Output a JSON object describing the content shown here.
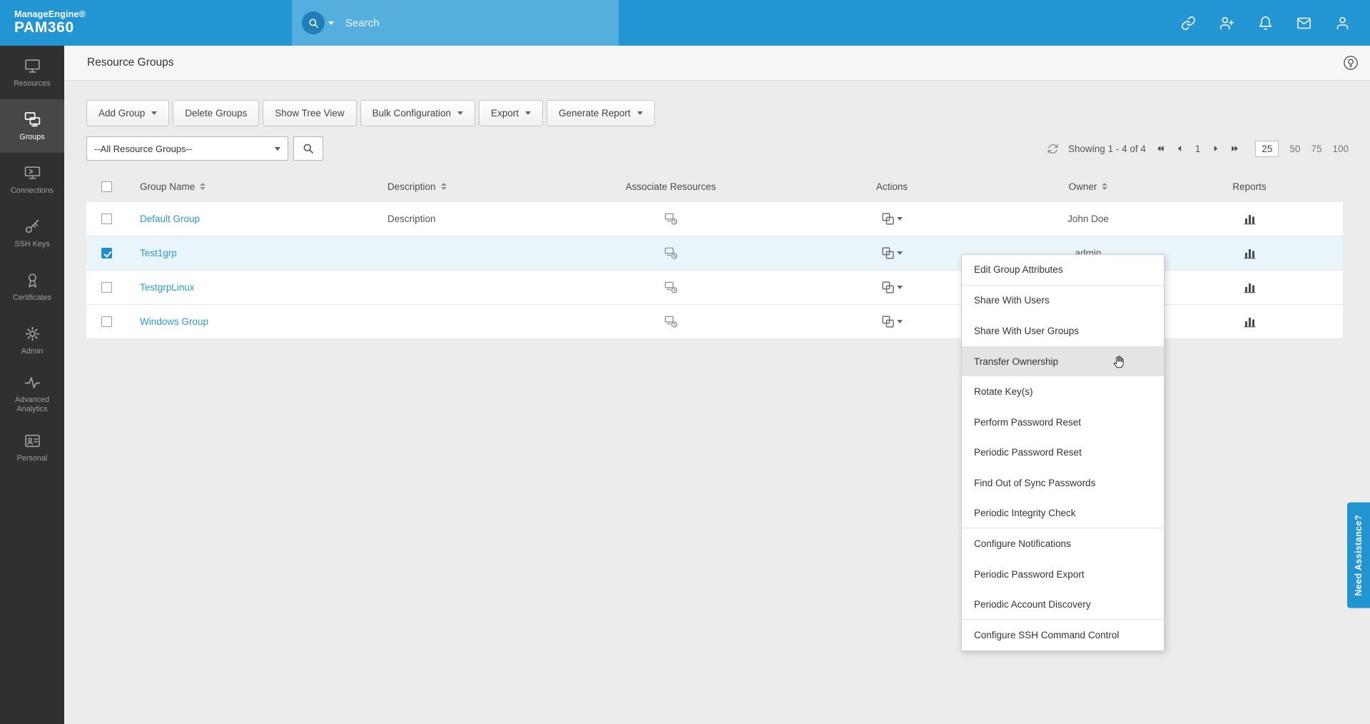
{
  "topbar": {
    "brand_line1": "ManageEngine®",
    "brand_line2": "PAM360",
    "search_placeholder": "Search"
  },
  "sidebar": {
    "items": [
      {
        "label": "Resources",
        "active": false
      },
      {
        "label": "Groups",
        "active": true
      },
      {
        "label": "Connections",
        "active": false
      },
      {
        "label": "SSH Keys",
        "active": false
      },
      {
        "label": "Certificates",
        "active": false
      },
      {
        "label": "Admin",
        "active": false
      },
      {
        "label": "Advanced Analytics",
        "active": false
      },
      {
        "label": "Personal",
        "active": false
      }
    ]
  },
  "page": {
    "title": "Resource Groups"
  },
  "toolbar": {
    "buttons": [
      {
        "label": "Add Group",
        "caret": true
      },
      {
        "label": "Delete Groups",
        "caret": false
      },
      {
        "label": "Show Tree View",
        "caret": false
      },
      {
        "label": "Bulk Configuration",
        "caret": true
      },
      {
        "label": "Export",
        "caret": true
      },
      {
        "label": "Generate Report",
        "caret": true
      }
    ]
  },
  "filter": {
    "selected_option": "--All Resource Groups--"
  },
  "pagination": {
    "showing_text": "Showing 1 - 4 of 4",
    "current_page": "1",
    "page_sizes": [
      "25",
      "50",
      "75",
      "100"
    ],
    "selected_size": "25"
  },
  "table": {
    "columns": [
      {
        "label": "Group Name",
        "sortable": true
      },
      {
        "label": "Description",
        "sortable": true
      },
      {
        "label": "Associate Resources",
        "sortable": false
      },
      {
        "label": "Actions",
        "sortable": false
      },
      {
        "label": "Owner",
        "sortable": true
      },
      {
        "label": "Reports",
        "sortable": false
      }
    ],
    "rows": [
      {
        "name": "Default Group",
        "description": "Description",
        "owner": "John Doe",
        "checked": false,
        "selected": false
      },
      {
        "name": "Test1grp",
        "description": "",
        "owner": "admin",
        "checked": true,
        "selected": true
      },
      {
        "name": "TestgrpLinux",
        "description": "",
        "owner": "",
        "checked": false,
        "selected": false
      },
      {
        "name": "Windows Group",
        "description": "",
        "owner": "",
        "checked": false,
        "selected": false
      }
    ]
  },
  "context_menu": {
    "items": [
      {
        "label": "Edit Group Attributes",
        "divider_after": true
      },
      {
        "label": "Share With Users"
      },
      {
        "label": "Share With User Groups"
      },
      {
        "label": "Transfer Ownership",
        "highlighted": true
      },
      {
        "label": "Rotate Key(s)"
      },
      {
        "label": "Perform Password Reset"
      },
      {
        "label": "Periodic Password Reset"
      },
      {
        "label": "Find Out of Sync Passwords"
      },
      {
        "label": "Periodic Integrity Check",
        "divider_after": true
      },
      {
        "label": "Configure Notifications"
      },
      {
        "label": "Periodic Password Export"
      },
      {
        "label": "Periodic Account Discovery",
        "divider_after": true
      },
      {
        "label": "Configure SSH Command Control"
      }
    ]
  },
  "assist_tab": {
    "label": "Need Assistance?"
  },
  "colors": {
    "topbar_blue": "#2495d3",
    "search_block_blue": "#54aede",
    "sidebar_dark": "#303030",
    "sidebar_active": "#474747",
    "link_blue": "#2b9ad3",
    "selected_row": "#e9f4fb",
    "accent_blue": "#1e90d2"
  }
}
